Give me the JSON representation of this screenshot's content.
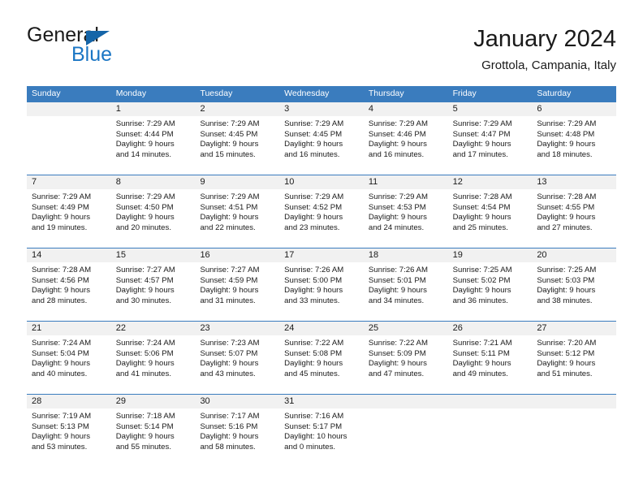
{
  "brand": {
    "line1": "General",
    "line2": "Blue",
    "triangle_color": "#1565a8",
    "blue_color": "#1b76c4"
  },
  "header": {
    "title": "January 2024",
    "subtitle": "Grottola, Campania, Italy"
  },
  "colors": {
    "header_blue": "#3a7cbe",
    "daynum_band": "#f1f1f1",
    "text": "#1a1a1a"
  },
  "weekdays": [
    "Sunday",
    "Monday",
    "Tuesday",
    "Wednesday",
    "Thursday",
    "Friday",
    "Saturday"
  ],
  "weeks": [
    [
      {
        "num": "",
        "sunrise": "",
        "sunset": "",
        "daylight1": "",
        "daylight2": ""
      },
      {
        "num": "1",
        "sunrise": "Sunrise: 7:29 AM",
        "sunset": "Sunset: 4:44 PM",
        "daylight1": "Daylight: 9 hours",
        "daylight2": "and 14 minutes."
      },
      {
        "num": "2",
        "sunrise": "Sunrise: 7:29 AM",
        "sunset": "Sunset: 4:45 PM",
        "daylight1": "Daylight: 9 hours",
        "daylight2": "and 15 minutes."
      },
      {
        "num": "3",
        "sunrise": "Sunrise: 7:29 AM",
        "sunset": "Sunset: 4:45 PM",
        "daylight1": "Daylight: 9 hours",
        "daylight2": "and 16 minutes."
      },
      {
        "num": "4",
        "sunrise": "Sunrise: 7:29 AM",
        "sunset": "Sunset: 4:46 PM",
        "daylight1": "Daylight: 9 hours",
        "daylight2": "and 16 minutes."
      },
      {
        "num": "5",
        "sunrise": "Sunrise: 7:29 AM",
        "sunset": "Sunset: 4:47 PM",
        "daylight1": "Daylight: 9 hours",
        "daylight2": "and 17 minutes."
      },
      {
        "num": "6",
        "sunrise": "Sunrise: 7:29 AM",
        "sunset": "Sunset: 4:48 PM",
        "daylight1": "Daylight: 9 hours",
        "daylight2": "and 18 minutes."
      }
    ],
    [
      {
        "num": "7",
        "sunrise": "Sunrise: 7:29 AM",
        "sunset": "Sunset: 4:49 PM",
        "daylight1": "Daylight: 9 hours",
        "daylight2": "and 19 minutes."
      },
      {
        "num": "8",
        "sunrise": "Sunrise: 7:29 AM",
        "sunset": "Sunset: 4:50 PM",
        "daylight1": "Daylight: 9 hours",
        "daylight2": "and 20 minutes."
      },
      {
        "num": "9",
        "sunrise": "Sunrise: 7:29 AM",
        "sunset": "Sunset: 4:51 PM",
        "daylight1": "Daylight: 9 hours",
        "daylight2": "and 22 minutes."
      },
      {
        "num": "10",
        "sunrise": "Sunrise: 7:29 AM",
        "sunset": "Sunset: 4:52 PM",
        "daylight1": "Daylight: 9 hours",
        "daylight2": "and 23 minutes."
      },
      {
        "num": "11",
        "sunrise": "Sunrise: 7:29 AM",
        "sunset": "Sunset: 4:53 PM",
        "daylight1": "Daylight: 9 hours",
        "daylight2": "and 24 minutes."
      },
      {
        "num": "12",
        "sunrise": "Sunrise: 7:28 AM",
        "sunset": "Sunset: 4:54 PM",
        "daylight1": "Daylight: 9 hours",
        "daylight2": "and 25 minutes."
      },
      {
        "num": "13",
        "sunrise": "Sunrise: 7:28 AM",
        "sunset": "Sunset: 4:55 PM",
        "daylight1": "Daylight: 9 hours",
        "daylight2": "and 27 minutes."
      }
    ],
    [
      {
        "num": "14",
        "sunrise": "Sunrise: 7:28 AM",
        "sunset": "Sunset: 4:56 PM",
        "daylight1": "Daylight: 9 hours",
        "daylight2": "and 28 minutes."
      },
      {
        "num": "15",
        "sunrise": "Sunrise: 7:27 AM",
        "sunset": "Sunset: 4:57 PM",
        "daylight1": "Daylight: 9 hours",
        "daylight2": "and 30 minutes."
      },
      {
        "num": "16",
        "sunrise": "Sunrise: 7:27 AM",
        "sunset": "Sunset: 4:59 PM",
        "daylight1": "Daylight: 9 hours",
        "daylight2": "and 31 minutes."
      },
      {
        "num": "17",
        "sunrise": "Sunrise: 7:26 AM",
        "sunset": "Sunset: 5:00 PM",
        "daylight1": "Daylight: 9 hours",
        "daylight2": "and 33 minutes."
      },
      {
        "num": "18",
        "sunrise": "Sunrise: 7:26 AM",
        "sunset": "Sunset: 5:01 PM",
        "daylight1": "Daylight: 9 hours",
        "daylight2": "and 34 minutes."
      },
      {
        "num": "19",
        "sunrise": "Sunrise: 7:25 AM",
        "sunset": "Sunset: 5:02 PM",
        "daylight1": "Daylight: 9 hours",
        "daylight2": "and 36 minutes."
      },
      {
        "num": "20",
        "sunrise": "Sunrise: 7:25 AM",
        "sunset": "Sunset: 5:03 PM",
        "daylight1": "Daylight: 9 hours",
        "daylight2": "and 38 minutes."
      }
    ],
    [
      {
        "num": "21",
        "sunrise": "Sunrise: 7:24 AM",
        "sunset": "Sunset: 5:04 PM",
        "daylight1": "Daylight: 9 hours",
        "daylight2": "and 40 minutes."
      },
      {
        "num": "22",
        "sunrise": "Sunrise: 7:24 AM",
        "sunset": "Sunset: 5:06 PM",
        "daylight1": "Daylight: 9 hours",
        "daylight2": "and 41 minutes."
      },
      {
        "num": "23",
        "sunrise": "Sunrise: 7:23 AM",
        "sunset": "Sunset: 5:07 PM",
        "daylight1": "Daylight: 9 hours",
        "daylight2": "and 43 minutes."
      },
      {
        "num": "24",
        "sunrise": "Sunrise: 7:22 AM",
        "sunset": "Sunset: 5:08 PM",
        "daylight1": "Daylight: 9 hours",
        "daylight2": "and 45 minutes."
      },
      {
        "num": "25",
        "sunrise": "Sunrise: 7:22 AM",
        "sunset": "Sunset: 5:09 PM",
        "daylight1": "Daylight: 9 hours",
        "daylight2": "and 47 minutes."
      },
      {
        "num": "26",
        "sunrise": "Sunrise: 7:21 AM",
        "sunset": "Sunset: 5:11 PM",
        "daylight1": "Daylight: 9 hours",
        "daylight2": "and 49 minutes."
      },
      {
        "num": "27",
        "sunrise": "Sunrise: 7:20 AM",
        "sunset": "Sunset: 5:12 PM",
        "daylight1": "Daylight: 9 hours",
        "daylight2": "and 51 minutes."
      }
    ],
    [
      {
        "num": "28",
        "sunrise": "Sunrise: 7:19 AM",
        "sunset": "Sunset: 5:13 PM",
        "daylight1": "Daylight: 9 hours",
        "daylight2": "and 53 minutes."
      },
      {
        "num": "29",
        "sunrise": "Sunrise: 7:18 AM",
        "sunset": "Sunset: 5:14 PM",
        "daylight1": "Daylight: 9 hours",
        "daylight2": "and 55 minutes."
      },
      {
        "num": "30",
        "sunrise": "Sunrise: 7:17 AM",
        "sunset": "Sunset: 5:16 PM",
        "daylight1": "Daylight: 9 hours",
        "daylight2": "and 58 minutes."
      },
      {
        "num": "31",
        "sunrise": "Sunrise: 7:16 AM",
        "sunset": "Sunset: 5:17 PM",
        "daylight1": "Daylight: 10 hours",
        "daylight2": "and 0 minutes."
      },
      {
        "num": "",
        "sunrise": "",
        "sunset": "",
        "daylight1": "",
        "daylight2": ""
      },
      {
        "num": "",
        "sunrise": "",
        "sunset": "",
        "daylight1": "",
        "daylight2": ""
      },
      {
        "num": "",
        "sunrise": "",
        "sunset": "",
        "daylight1": "",
        "daylight2": ""
      }
    ]
  ]
}
